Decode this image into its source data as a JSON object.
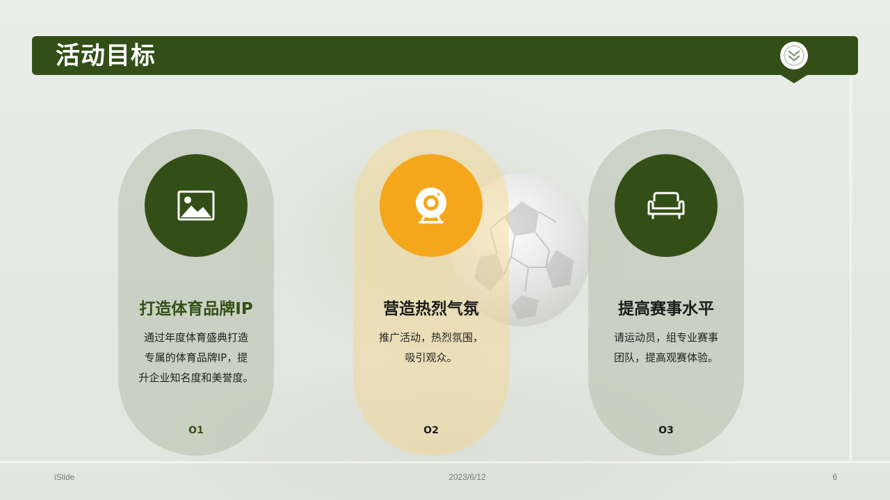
{
  "header": {
    "title": "活动目标",
    "badge_icon": "double-chevron-down-icon",
    "bar_color": "#334f17"
  },
  "cards": [
    {
      "icon": "image-icon",
      "circle_color": "#334f17",
      "title": "打造体育品牌IP",
      "desc_lines": [
        "通过年度体育盛典打造",
        "专属的体育品牌IP，提",
        "升企业知名度和美誉度。"
      ],
      "number": "O1"
    },
    {
      "icon": "webcam-icon",
      "circle_color": "#f5a71c",
      "title": "营造热烈气氛",
      "desc_lines": [
        "推广活动，热烈氛围，",
        "吸引观众。"
      ],
      "number": "O2"
    },
    {
      "icon": "sofa-icon",
      "circle_color": "#334f17",
      "title": "提高赛事水平",
      "desc_lines": [
        "请运动员，组专业赛事",
        "团队，提高观赛体验。"
      ],
      "number": "O3"
    }
  ],
  "footer": {
    "left": "iSlide",
    "center": "2023/6/12",
    "right": "6"
  }
}
